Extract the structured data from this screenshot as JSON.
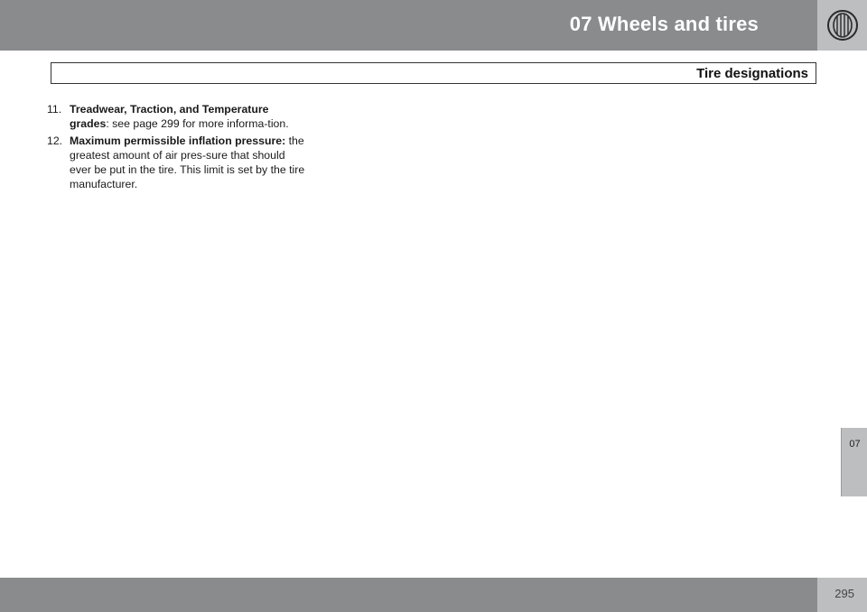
{
  "header": {
    "chapter_title": "07  Wheels and tires",
    "icon": "tire-icon"
  },
  "section": {
    "title": "Tire designations"
  },
  "items": [
    {
      "number": "11.",
      "bold": "Treadwear, Traction, and Temperature grades",
      "text": ": see page 299 for more informa-tion."
    },
    {
      "number": "12.",
      "bold": "Maximum permissible inflation pressure:",
      "text": " the greatest amount of air pres-sure that should ever be put in the tire. This limit is set by the tire manufacturer."
    }
  ],
  "side_tab": {
    "label": "07"
  },
  "footer": {
    "page_number": "295"
  },
  "colors": {
    "header_bar": "#8a8b8d",
    "icon_box": "#bdbec0",
    "text": "#1a1a1a"
  }
}
